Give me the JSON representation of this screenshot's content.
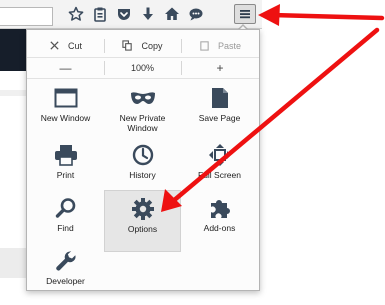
{
  "toolbar": {
    "icons": [
      "star-icon",
      "clipboard-icon",
      "pocket-icon",
      "download-icon",
      "home-icon",
      "chat-icon",
      "hamburger-menu-icon"
    ]
  },
  "menu": {
    "edit": {
      "cut": "Cut",
      "copy": "Copy",
      "paste": "Paste"
    },
    "zoom": {
      "minus": "—",
      "level": "100%",
      "plus": "+"
    },
    "items": [
      {
        "label": "New Window",
        "icon": "window-icon"
      },
      {
        "label": "New Private Window",
        "icon": "mask-icon"
      },
      {
        "label": "Save Page",
        "icon": "page-icon"
      },
      {
        "label": "Print",
        "icon": "printer-icon"
      },
      {
        "label": "History",
        "icon": "clock-icon"
      },
      {
        "label": "Full Screen",
        "icon": "fullscreen-icon"
      },
      {
        "label": "Find",
        "icon": "magnifier-icon"
      },
      {
        "label": "Options",
        "icon": "gear-icon"
      },
      {
        "label": "Add-ons",
        "icon": "puzzle-icon"
      },
      {
        "label": "Developer",
        "icon": "wrench-icon"
      }
    ]
  },
  "colors": {
    "arrow": "#ee1111",
    "icon": "#3a4a5c",
    "highlight": "#e6e6e6"
  }
}
